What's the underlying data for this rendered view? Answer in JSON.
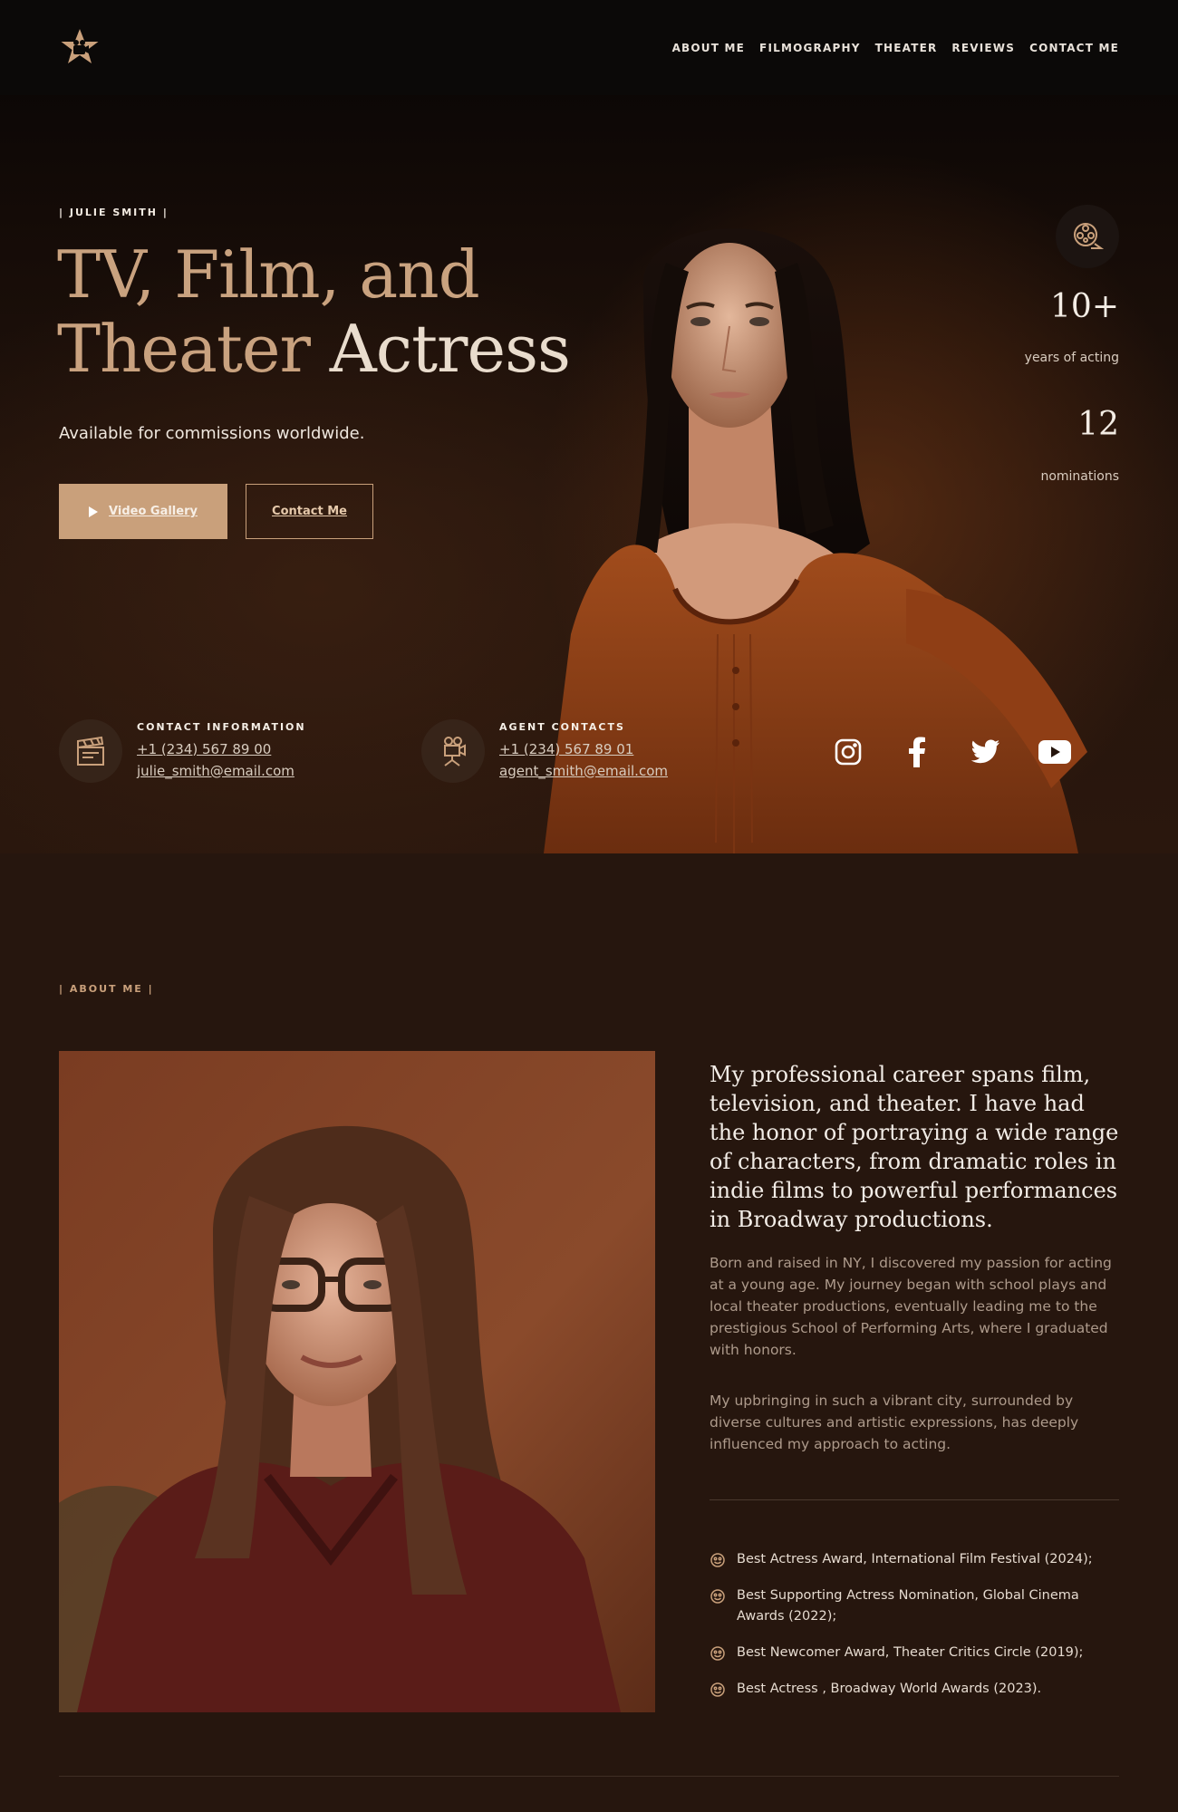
{
  "nav": {
    "logo_icon": "star-camera-logo-icon",
    "items": [
      "ABOUT ME",
      "FILMOGRAPHY",
      "THEATER",
      "REVIEWS",
      "CONTACT ME"
    ]
  },
  "hero": {
    "eyebrow": "| JULIE SMITH |",
    "headline_line1": "TV, Film, and",
    "headline_line2_a": "Theater",
    "headline_line2_b": "Actress",
    "tagline": "Available for commissions worldwide.",
    "primary_button": "Video Gallery",
    "primary_button_icon": "play-icon",
    "secondary_button": "Contact Me",
    "stats_icon": "film-reel-icon",
    "stats": [
      {
        "value": "10+",
        "label": "years of acting"
      },
      {
        "value": "12",
        "label": "nominations"
      }
    ],
    "contact": {
      "icon": "clapperboard-icon",
      "title": "CONTACT INFORMATION",
      "phone": "+1 (234) 567 89 00",
      "email": "julie_smith@email.com"
    },
    "agent": {
      "icon": "movie-camera-icon",
      "title": "AGENT CONTACTS",
      "phone": "+1 (234) 567 89 01",
      "email": "agent_smith@email.com"
    },
    "socials": [
      "instagram-icon",
      "facebook-icon",
      "twitter-icon",
      "youtube-icon"
    ]
  },
  "about": {
    "eyebrow": "| ABOUT ME |",
    "lead": "My professional career spans film, television, and theater. I have had the honor of portraying a wide range of characters, from dramatic roles in indie films to powerful performances in Broadway productions.",
    "para1": "Born and raised in NY, I discovered my passion for acting at a young age. My journey began with school plays and local theater productions, eventually leading me to the prestigious School of Performing Arts, where I graduated with honors.",
    "para2": "My upbringing in such a vibrant city, surrounded by diverse cultures and artistic expressions, has deeply influenced my approach to acting.",
    "award_icon": "theater-masks-icon",
    "awards": [
      "Best Actress Award, International Film Festival (2024);",
      "Best Supporting Actress Nomination, Global Cinema Awards (2022);",
      "Best Newcomer Award, Theater Critics Circle (2019);",
      "Best Actress , Broadway World Awards (2023)."
    ]
  },
  "colors": {
    "accent": "#c9a07b",
    "background": "#26160e",
    "nav_background": "#0b0908"
  }
}
